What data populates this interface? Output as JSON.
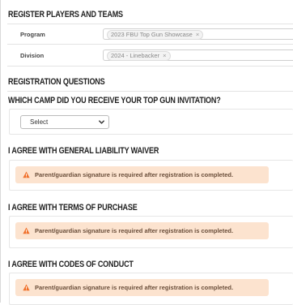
{
  "register": {
    "heading": "REGISTER PLAYERS AND TEAMS",
    "program_label": "Program",
    "program_value": "2023 FBU Top Gun Showcase",
    "division_label": "Division",
    "division_value": "2024 - Linebacker",
    "remove_symbol": "×"
  },
  "questions": {
    "heading": "REGISTRATION QUESTIONS",
    "camp_question": "WHICH CAMP DID YOU RECEIVE YOUR TOP GUN INVITATION?",
    "camp_select_value": "Select"
  },
  "waivers": [
    {
      "title": "I AGREE WITH GENERAL LIABILITY WAIVER",
      "alert": "Parent/guardian signature is required after registration is completed."
    },
    {
      "title": "I AGREE WITH TERMS OF PURCHASE",
      "alert": "Parent/guardian signature is required after registration is completed."
    },
    {
      "title": "I AGREE WITH CODES OF CONDUCT",
      "alert": "Parent/guardian signature is required after registration is completed."
    }
  ],
  "colors": {
    "alert_background": "#fce3cf",
    "warning_icon": "#f0712c"
  },
  "icons": {
    "warning": "warning-triangle-icon",
    "select_caret": "chevron-down-icon",
    "chip_remove": "close-icon"
  }
}
